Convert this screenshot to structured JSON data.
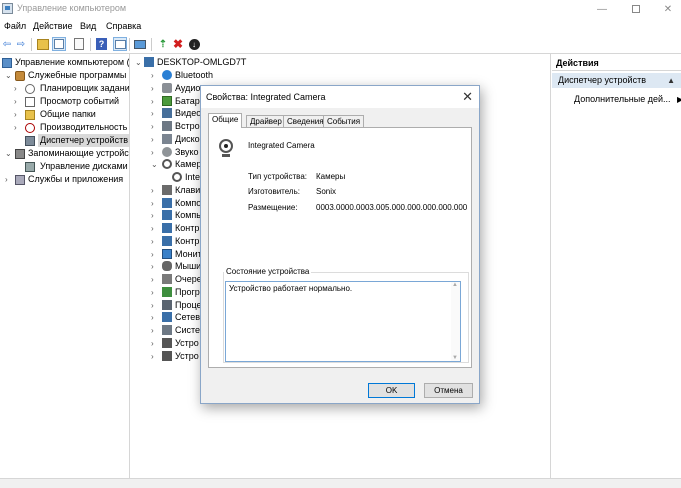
{
  "window": {
    "title": "Управление компьютером"
  },
  "menu": [
    "Файл",
    "Действие",
    "Вид",
    "Справка"
  ],
  "left_tree": [
    {
      "label": "Управление компьютером (л",
      "level": 0,
      "arrow": "",
      "icon": "computer"
    },
    {
      "label": "Служебные программы",
      "level": 1,
      "arrow": "⌄",
      "icon": "tools"
    },
    {
      "label": "Планировщик заданий",
      "level": 2,
      "arrow": "›",
      "icon": "clock"
    },
    {
      "label": "Просмотр событий",
      "level": 2,
      "arrow": "›",
      "icon": "events"
    },
    {
      "label": "Общие папки",
      "level": 2,
      "arrow": "›",
      "icon": "folder"
    },
    {
      "label": "Производительность",
      "level": 2,
      "arrow": "›",
      "icon": "perf"
    },
    {
      "label": "Диспетчер устройств",
      "level": 2,
      "arrow": "",
      "icon": "devmgr",
      "selected": true
    },
    {
      "label": "Запоминающие устройств",
      "level": 1,
      "arrow": "⌄",
      "icon": "storage"
    },
    {
      "label": "Управление дисками",
      "level": 2,
      "arrow": "",
      "icon": "disk"
    },
    {
      "label": "Службы и приложения",
      "level": 1,
      "arrow": "›",
      "icon": "services"
    }
  ],
  "device_tree": {
    "root": "DESKTOP-OMLGD7T",
    "items": [
      {
        "label": "Bluetooth",
        "icon": "bt",
        "arrow": "›"
      },
      {
        "label": "Аудио",
        "icon": "audio",
        "arrow": "›"
      },
      {
        "label": "Батаре",
        "icon": "battery",
        "arrow": "›"
      },
      {
        "label": "Видео",
        "icon": "video",
        "arrow": "›"
      },
      {
        "label": "Встрое",
        "icon": "builtin",
        "arrow": "›"
      },
      {
        "label": "Диско",
        "icon": "disk",
        "arrow": "›"
      },
      {
        "label": "Звуко",
        "icon": "sound",
        "arrow": "›"
      },
      {
        "label": "Камер",
        "icon": "camera",
        "arrow": "⌄"
      },
      {
        "label": "Inte",
        "icon": "camera",
        "arrow": "",
        "child": true
      },
      {
        "label": "Клави",
        "icon": "kbd",
        "arrow": "›"
      },
      {
        "label": "Компо",
        "icon": "comp",
        "arrow": "›"
      },
      {
        "label": "Компь",
        "icon": "comp",
        "arrow": "›"
      },
      {
        "label": "Контр",
        "icon": "comp",
        "arrow": "›"
      },
      {
        "label": "Контр",
        "icon": "comp",
        "arrow": "›"
      },
      {
        "label": "Монит",
        "icon": "monitor",
        "arrow": "›"
      },
      {
        "label": "Мыши",
        "icon": "mouse",
        "arrow": "›"
      },
      {
        "label": "Очере",
        "icon": "queue",
        "arrow": "›"
      },
      {
        "label": "Прогр",
        "icon": "prog",
        "arrow": "›"
      },
      {
        "label": "Проце",
        "icon": "cpu",
        "arrow": "›"
      },
      {
        "label": "Сетев",
        "icon": "net",
        "arrow": "›"
      },
      {
        "label": "Систе",
        "icon": "sys",
        "arrow": "›"
      },
      {
        "label": "Устро",
        "icon": "usb",
        "arrow": "›"
      },
      {
        "label": "Устро",
        "icon": "usb",
        "arrow": "›"
      }
    ]
  },
  "actions": {
    "header": "Действия",
    "section": "Диспетчер устройств",
    "more": "Дополнительные дей..."
  },
  "dialog": {
    "title": "Свойства: Integrated Camera",
    "tabs": [
      "Общие",
      "Драйвер",
      "Сведения",
      "События"
    ],
    "device_name": "Integrated Camera",
    "props": [
      {
        "label": "Тип устройства:",
        "value": "Камеры"
      },
      {
        "label": "Изготовитель:",
        "value": "Sonix"
      },
      {
        "label": "Размещение:",
        "value": "0003.0000.0003.005.000.000.000.000.000"
      }
    ],
    "status_legend": "Состояние устройства",
    "status_text": "Устройство работает нормально.",
    "ok": "OK",
    "cancel": "Отмена"
  }
}
